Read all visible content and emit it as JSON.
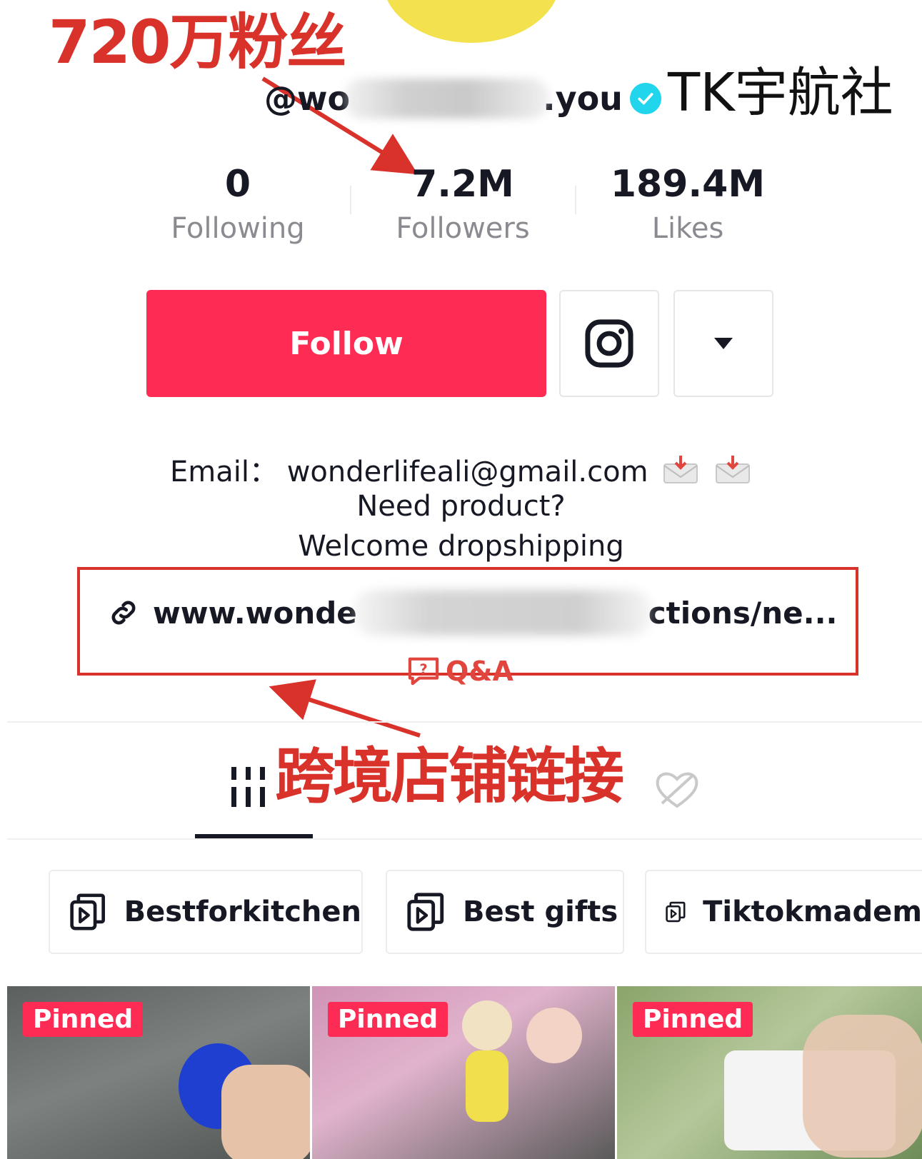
{
  "annotations": {
    "fans_count_cn": "720万粉丝",
    "watermark": "TK宇航社",
    "shop_link_cn": "跨境店铺链接"
  },
  "profile": {
    "username_start": "@wo",
    "username_end": ".you",
    "verified": true
  },
  "stats": [
    {
      "value": "0",
      "label": "Following"
    },
    {
      "value": "7.2M",
      "label": "Followers"
    },
    {
      "value": "189.4M",
      "label": "Likes"
    }
  ],
  "actions": {
    "follow_label": "Follow",
    "instagram_icon": "instagram-icon",
    "more_icon": "caret-down-icon"
  },
  "bio": {
    "email_label": "Email：",
    "email_value": "wonderlifeali@gmail.com",
    "line2": "Need product?",
    "line3": "Welcome dropshipping"
  },
  "link": {
    "start": "www.wonde",
    "end": "ctions/ne..."
  },
  "qa_label": "Q&A",
  "playlists": [
    {
      "name": "Bestforkitchen"
    },
    {
      "name": "Best gifts"
    },
    {
      "name": "Tiktokmadem"
    }
  ],
  "videos": [
    {
      "badge": "Pinned"
    },
    {
      "badge": "Pinned"
    },
    {
      "badge": "Pinned"
    }
  ],
  "colors": {
    "brand_red": "#fe2c55",
    "annotation_red": "#d8322b",
    "verified_blue": "#20d5ec",
    "muted_text": "#8a8b91"
  }
}
